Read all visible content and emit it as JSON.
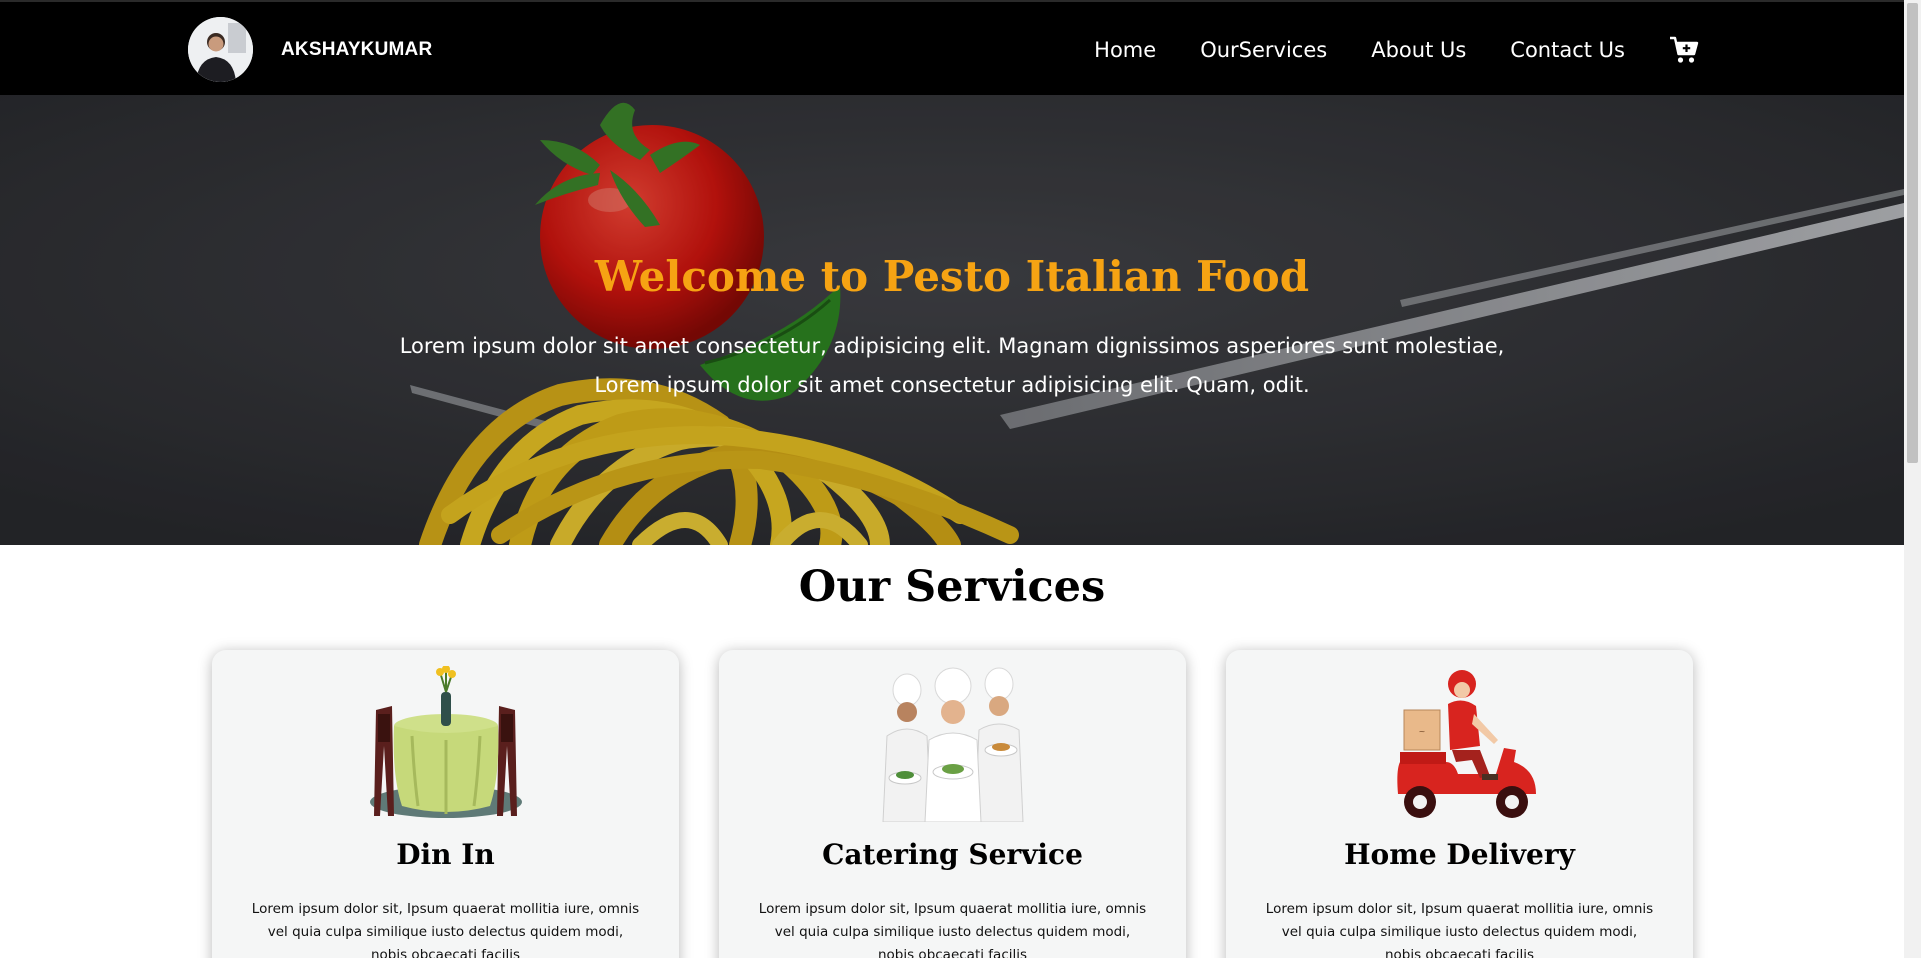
{
  "navbar": {
    "brand_name": "AKSHAYKUMAR",
    "links": [
      {
        "label": "Home"
      },
      {
        "label": "OurServices"
      },
      {
        "label": "About Us"
      },
      {
        "label": "Contact Us"
      }
    ],
    "cart_icon": "cart-plus-icon"
  },
  "hero": {
    "title": "Welcome to Pesto Italian Food",
    "text_line1": "Lorem ipsum dolor sit amet consectetur, adipisicing elit. Magnam dignissimos asperiores sunt molestiae,",
    "text_line2": "Lorem ipsum dolor sit amet consectetur adipisicing elit. Quam, odit."
  },
  "services": {
    "heading": "Our Services",
    "cards": [
      {
        "title": "Din In",
        "text": "Lorem ipsum dolor sit, Ipsum quaerat mollitia iure, omnis vel quia culpa similique iusto delectus quidem modi, nobis obcaecati facilis",
        "icon": "dining-table-icon"
      },
      {
        "title": "Catering Service",
        "text": "Lorem ipsum dolor sit, Ipsum quaerat mollitia iure, omnis vel quia culpa similique iusto delectus quidem modi, nobis obcaecati facilis",
        "icon": "chefs-icon"
      },
      {
        "title": "Home Delivery",
        "text": "Lorem ipsum dolor sit, Ipsum quaerat mollitia iure, omnis vel quia culpa similique iusto delectus quidem modi, nobis obcaecati facilis",
        "icon": "delivery-scooter-icon"
      }
    ]
  },
  "colors": {
    "navbar_bg": "#000000",
    "hero_title": "#f6a313",
    "card_bg": "#f5f6f6"
  }
}
